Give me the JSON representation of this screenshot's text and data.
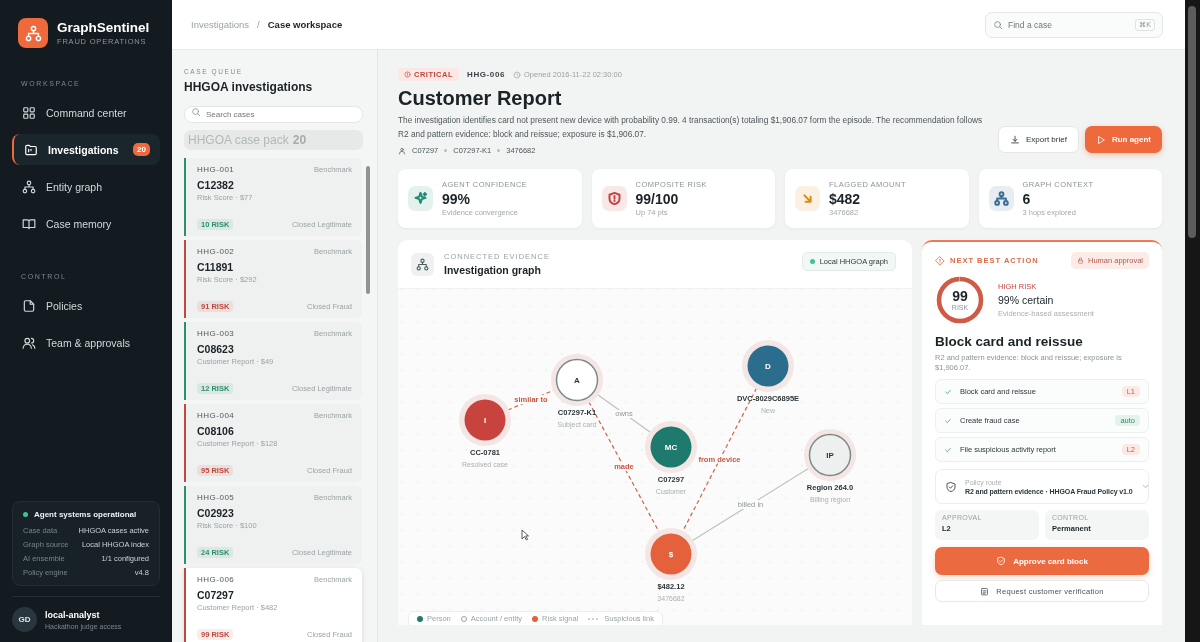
{
  "sidebar": {
    "brand": {
      "name": "GraphSentinel",
      "tagline": "FRAUD OPERATIONS"
    },
    "sections": [
      {
        "heading": "WORKSPACE",
        "items": [
          {
            "label": "Command center",
            "selected": false
          },
          {
            "label": "Investigations",
            "selected": true,
            "badge": "20"
          },
          {
            "label": "Entity graph",
            "selected": false
          },
          {
            "label": "Case memory",
            "selected": false
          }
        ]
      },
      {
        "heading": "CONTROL",
        "items": [
          {
            "label": "Policies",
            "selected": false
          },
          {
            "label": "Team & approvals",
            "selected": false
          }
        ]
      }
    ],
    "status": {
      "title": "Agent systems operational",
      "rows": [
        {
          "label": "Case data",
          "value": "HHGOA cases active"
        },
        {
          "label": "Graph source",
          "value": "Local HHGOA index"
        },
        {
          "label": "AI ensemble",
          "value": "1/1 configured"
        },
        {
          "label": "Policy engine",
          "value": "v4.8"
        }
      ]
    },
    "user": {
      "initials": "GD",
      "name": "local-analyst",
      "role": "Hackathon judge access"
    }
  },
  "topbar": {
    "breadcrumb": [
      "Investigations",
      "Case workspace"
    ],
    "separator": "/",
    "search": {
      "placeholder": "Find a case",
      "shortcut": "⌘K"
    }
  },
  "queue": {
    "eyebrow": "CASE QUEUE",
    "title": "HHGOA investigations",
    "search": {
      "placeholder": "Search cases"
    },
    "pack": {
      "label": "HHGOA case pack",
      "count": "20"
    },
    "cases": [
      {
        "id": "HHG-001",
        "tag": "Benchmark",
        "name": "C12382",
        "subtitle": "Risk Score · $77",
        "risk": "10 RISK",
        "kind": "low",
        "status": "Closed Legitimate",
        "selected": false
      },
      {
        "id": "HHG-002",
        "tag": "Benchmark",
        "name": "C11891",
        "subtitle": "Risk Score · $292",
        "risk": "91 RISK",
        "kind": "high",
        "status": "Closed Fraud",
        "selected": false
      },
      {
        "id": "HHG-003",
        "tag": "Benchmark",
        "name": "C08623",
        "subtitle": "Customer Report · $49",
        "risk": "12 RISK",
        "kind": "low",
        "status": "Closed Legitimate",
        "selected": false
      },
      {
        "id": "HHG-004",
        "tag": "Benchmark",
        "name": "C08106",
        "subtitle": "Customer Report · $128",
        "risk": "95 RISK",
        "kind": "high",
        "status": "Closed Fraud",
        "selected": false
      },
      {
        "id": "HHG-005",
        "tag": "Benchmark",
        "name": "C02923",
        "subtitle": "Risk Score · $100",
        "risk": "24 RISK",
        "kind": "low",
        "status": "Closed Legitimate",
        "selected": false
      },
      {
        "id": "HHG-006",
        "tag": "Benchmark",
        "name": "C07297",
        "subtitle": "Customer Report · $482",
        "risk": "99 RISK",
        "kind": "high",
        "status": "Closed Fraud",
        "selected": true
      }
    ]
  },
  "case": {
    "severity": "CRITICAL",
    "id": "HHG-006",
    "opened": "Opened 2016-11-22 02:30:00",
    "title": "Customer Report",
    "summary": "The investigation identifies card not present new device with probability 0.99. 4 transaction(s) totaling $1,906.07 form the episode. The recommendation follows R2 and pattern evidence: block and reissue; exposure is $1,906.07.",
    "meta": [
      "C07297",
      "C07297-K1",
      "3476682"
    ],
    "actions": [
      {
        "label": "Export brief",
        "kind": "secondary"
      },
      {
        "label": "Run agent",
        "kind": "primary"
      }
    ]
  },
  "stats": [
    {
      "label": "AGENT CONFIDENCE",
      "value": "99%",
      "note": "Evidence convergence",
      "color": "#1f8a74"
    },
    {
      "label": "COMPOSITE RISK",
      "value": "99/100",
      "note": "Up 74 pts",
      "color": "#c8423e"
    },
    {
      "label": "FLAGGED AMOUNT",
      "value": "$482",
      "note": "3476682",
      "color": "#d98a1c"
    },
    {
      "label": "GRAPH CONTEXT",
      "value": "6",
      "note": "3 hops explored",
      "color": "#3d6f95"
    }
  ],
  "graph": {
    "eyebrow": "CONNECTED EVIDENCE",
    "title": "Investigation graph",
    "source": "Local HHGOA graph",
    "nodes": [
      {
        "glyph": "I",
        "label": "CC-0781",
        "caption": "Resolved case",
        "kind": "solid",
        "color": "#c8423e"
      },
      {
        "glyph": "A",
        "label": "C07297-K1",
        "caption": "Subject card",
        "kind": "outline",
        "color": "#ffffff"
      },
      {
        "glyph": "MC",
        "label": "C07297",
        "caption": "Customer",
        "kind": "solid",
        "color": "#1e7a6c"
      },
      {
        "glyph": "D",
        "label": "DVC-8029C6895E",
        "caption": "New",
        "kind": "solid",
        "color": "#2b6d8c"
      },
      {
        "glyph": "IP",
        "label": "Region 264.0",
        "caption": "Billing region",
        "kind": "outline",
        "color": "#eef0ef"
      },
      {
        "glyph": "$",
        "label": "$482.12",
        "caption": "3476682",
        "kind": "solid",
        "color": "#e5613b"
      }
    ],
    "edges": [
      {
        "label": "similar to",
        "suspicious": true
      },
      {
        "label": "owns",
        "suspicious": false
      },
      {
        "label": "made",
        "suspicious": true
      },
      {
        "label": "from device",
        "suspicious": true
      },
      {
        "label": "billed in",
        "suspicious": false
      }
    ],
    "legend": [
      {
        "label": "Person",
        "kind": "person"
      },
      {
        "label": "Account / entity",
        "kind": "account"
      },
      {
        "label": "Risk signal",
        "kind": "risk"
      },
      {
        "label": "Suspicious link",
        "kind": "link"
      }
    ]
  },
  "decision": {
    "eyebrow": "NEXT BEST ACTION",
    "badge": "Human approval",
    "risk": {
      "score": "99",
      "unit": "RISK",
      "level": 0.99
    },
    "band": "HIGH RISK",
    "certainty": "99% certain",
    "basis": "Evidence-based assessment",
    "title": "Block card and reissue",
    "summary": "R2 and pattern evidence: block and reissue; exposure is $1,906.07.",
    "steps": [
      {
        "label": "Block card and reissue",
        "tag": "L1",
        "kind": "level",
        "checked": true
      },
      {
        "label": "Create fraud case",
        "tag": "auto",
        "kind": "auto",
        "checked": true
      },
      {
        "label": "File suspicious activity report",
        "tag": "L2",
        "kind": "level",
        "checked": true
      }
    ],
    "policy": {
      "label": "Policy route",
      "value": "R2 and pattern evidence · HHGOA Fraud Policy v1.0",
      "expanded": false
    },
    "fields": [
      {
        "label": "APPROVAL",
        "value": "L2"
      },
      {
        "label": "CONTROL",
        "value": "Permanent"
      }
    ],
    "buttons": [
      {
        "label": "Approve card block",
        "kind": "primary"
      },
      {
        "label": "Request customer verification",
        "kind": "secondary"
      }
    ]
  }
}
